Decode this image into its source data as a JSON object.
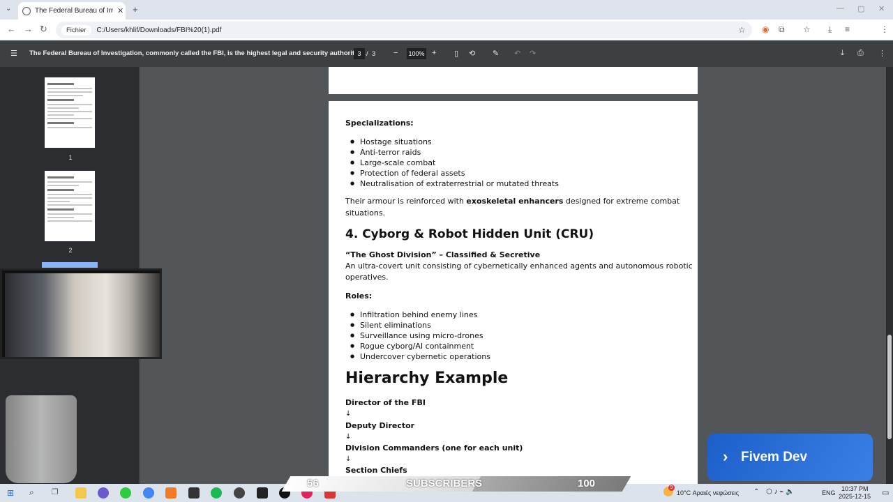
{
  "browser": {
    "tab_title": "The Federal Bureau of Investiga",
    "url_chip": "Fichier",
    "url": "C:/Users/khlif/Downloads/FBI%20(1).pdf"
  },
  "pdf_toolbar": {
    "title": "The Federal Bureau of Investigation, commonly called the FBI, is the highest legal and security authority ...",
    "current_page": "3",
    "page_sep": "/",
    "total_pages": "3",
    "zoom": "100%"
  },
  "sidebar": {
    "thumbs": [
      {
        "num": "1"
      },
      {
        "num": "2"
      }
    ]
  },
  "document": {
    "specializations_label": "Specializations:",
    "specializations": [
      "Hostage situations",
      "Anti-terror raids",
      "Large-scale combat",
      "Protection of federal assets",
      "Neutralisation of extraterrestrial or mutated threats"
    ],
    "armour_pre": "Their armour is reinforced with ",
    "armour_bold": "exoskeletal enhancers",
    "armour_post": " designed for extreme combat",
    "armour_line2": "situations.",
    "cru_heading": "4. Cyborg & Robot Hidden Unit (CRU)",
    "cru_sub": "“The Ghost Division” – Classified & Secretive",
    "cru_desc_1": "An ultra-covert unit consisting of cybernetically enhanced agents and autonomous robotic",
    "cru_desc_2": "operatives.",
    "roles_label": "Roles:",
    "roles": [
      "Infiltration behind enemy lines",
      "Silent eliminations",
      "Surveillance using micro-drones",
      "Rogue cyborg/AI containment",
      "Undercover cybernetic operations"
    ],
    "hierarchy_heading": "Hierarchy Example",
    "hierarchy": [
      "Director of the FBI",
      "Deputy Director",
      "Division Commanders (one for each unit)",
      "Section Chiefs"
    ],
    "arrow": "↓"
  },
  "overlays": {
    "fivem_label": "Fivem Dev",
    "sub_current": "56",
    "sub_label": "SUBSCRIBERS",
    "sub_goal": "100",
    "sub_progress_fraction": 0.56
  },
  "taskbar": {
    "weather": "10°C  Αραιές νεφώσεις",
    "weather_badge": "9",
    "lang": "ENG",
    "time": "10:37 PM",
    "date": "2025-12-15"
  },
  "colors": {
    "pdf_toolbar": "#3c4043",
    "viewer_bg": "#525659",
    "fivem_blue": "#2a6fd8"
  }
}
